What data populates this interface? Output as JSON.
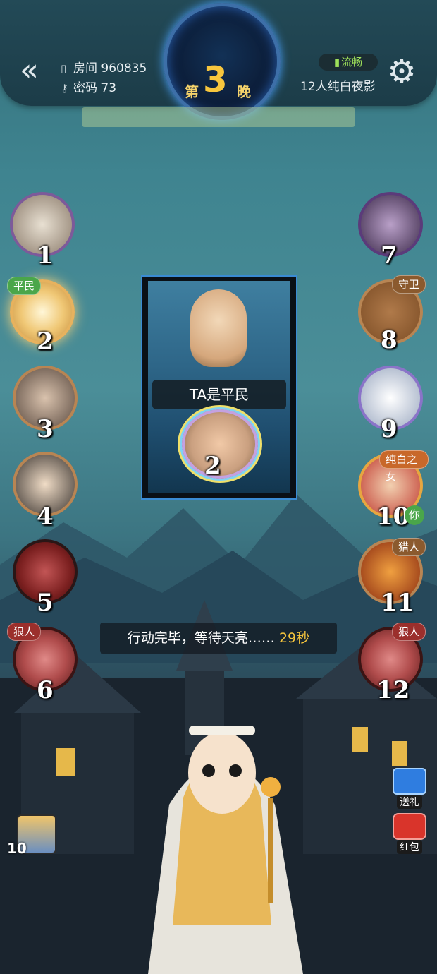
{
  "topbar": {
    "room_label": "房间 960835",
    "password_label": "密码 73",
    "night_prefix": "第",
    "night_number": "3",
    "night_suffix": "晚",
    "connection": "流畅",
    "mode": "12人纯白夜影"
  },
  "seats": {
    "s1": {
      "number": "1"
    },
    "s2": {
      "number": "2",
      "tag": "平民"
    },
    "s3": {
      "number": "3"
    },
    "s4": {
      "number": "4"
    },
    "s5": {
      "number": "5"
    },
    "s6": {
      "number": "6",
      "tag": "狼人"
    },
    "s7": {
      "number": "7"
    },
    "s8": {
      "number": "8",
      "tag": "守卫"
    },
    "s9": {
      "number": "9"
    },
    "s10": {
      "number": "10",
      "tag": "纯白之女",
      "you": "你"
    },
    "s11": {
      "number": "11",
      "tag": "猎人"
    },
    "s12": {
      "number": "12",
      "tag": "狼人"
    }
  },
  "card": {
    "caption": "TA是平民",
    "number": "2"
  },
  "status": {
    "text": "行动完毕，等待天亮……",
    "seconds": "29秒"
  },
  "actions": {
    "gift": "送礼",
    "redpack": "红包"
  },
  "mini_player": {
    "number": "10"
  },
  "colors": {
    "accent_gold": "#f7c63d",
    "connection_green": "#9ee05a",
    "frame_blue": "#3a8bd3"
  }
}
